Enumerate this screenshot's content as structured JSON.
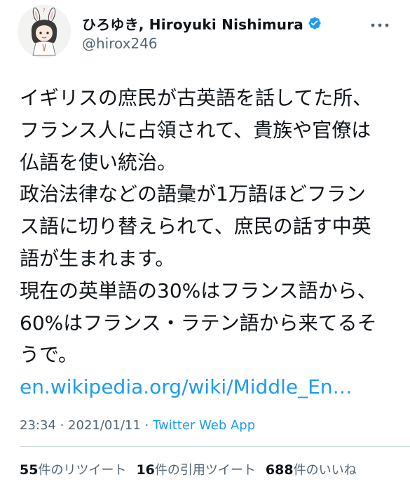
{
  "user": {
    "display_name": "ひろゆき, Hiroyuki Nishimura",
    "handle": "@hirox246",
    "verified": true
  },
  "tweet": {
    "lines": [
      "イギリスの庶民が古英語を話してた所、",
      "フランス人に占領されて、貴族や官僚は",
      "仏語を使い統治。",
      "政治法律などの語彙が1万語ほどフラン",
      "ス語に切り替えられて、庶民の話す中英",
      "語が生まれます。",
      "現在の英単語の30%はフランス語から、",
      "60%はフランス・ラテン語から来てるそ",
      "うで。"
    ],
    "link": "en.wikipedia.org/wiki/Middle_En…"
  },
  "meta": {
    "time": "23:34",
    "separator1": " · ",
    "date": "2021/01/11",
    "separator2": " · ",
    "source": "Twitter Web App"
  },
  "stats": {
    "retweets_count": "55",
    "retweets_label": "件のリツイート",
    "quotes_count": "16",
    "quotes_label": "件の引用ツイート",
    "likes_count": "688",
    "likes_label": "件のいいね"
  },
  "icons": {
    "verified": "verified-badge-icon",
    "more": "more-options-icon"
  },
  "colors": {
    "accent": "#1d9bf0",
    "text": "#0f1419",
    "secondary": "#536471",
    "divider": "#cfd9de"
  }
}
